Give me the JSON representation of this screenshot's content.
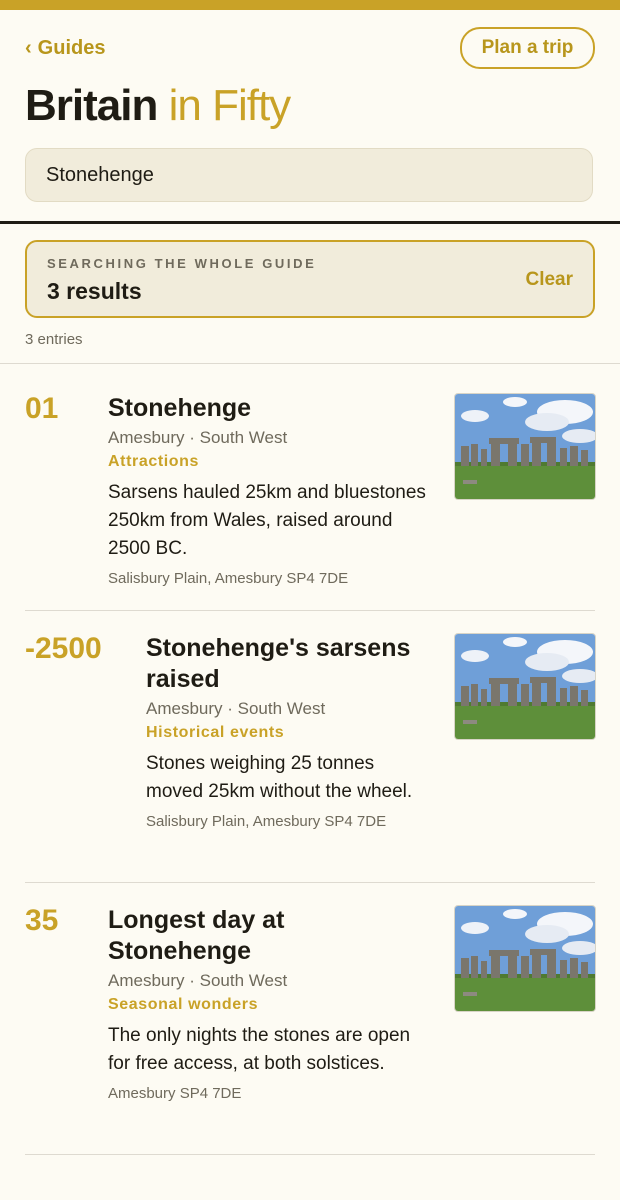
{
  "header": {
    "back_label": "Guides",
    "plan_label": "Plan a trip",
    "title_bold": "Britain",
    "title_light": "in Fifty"
  },
  "search": {
    "value": "Stonehenge"
  },
  "results": {
    "eyebrow": "SEARCHING THE WHOLE GUIDE",
    "count": "3 results",
    "clear_label": "Clear"
  },
  "entries_count": "3 entries",
  "entries": [
    {
      "number": "01",
      "name": "Stonehenge",
      "location": "Amesbury · South West",
      "category": "Attractions",
      "description": "Sarsens hauled 25km and bluestones 250km from Wales, raised around 2500 BC.",
      "address": "Salisbury Plain, Amesbury SP4 7DE",
      "image_icon": "stonehenge-photo"
    },
    {
      "number": "-2500",
      "name": "Stonehenge's sarsens raised",
      "location": "Amesbury · South West",
      "category": "Historical events",
      "description": "Stones weighing 25 tonnes moved 25km without the wheel.",
      "address": "Salisbury Plain, Amesbury SP4 7DE",
      "image_icon": "stonehenge-photo"
    },
    {
      "number": "35",
      "name": "Longest day at Stonehenge",
      "location": "Amesbury · South West",
      "category": "Seasonal wonders",
      "description": "The only nights the stones are open for free access, at both solstices.",
      "address": "Amesbury SP4 7DE",
      "image_icon": "stonehenge-photo"
    }
  ],
  "colors": {
    "accent": "#c9a227",
    "background": "#fdfbf3",
    "panel": "#f1ecdb",
    "ink": "#1f1c14"
  }
}
